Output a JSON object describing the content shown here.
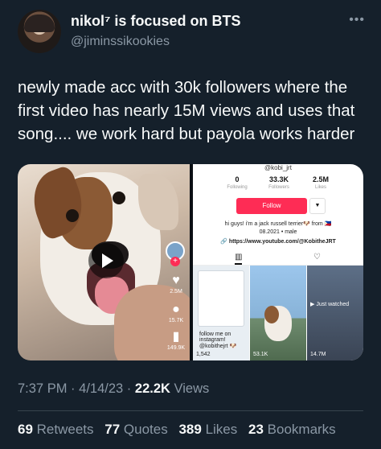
{
  "tweet": {
    "author": {
      "display_name": "nikol⁷ is focused on BTS",
      "handle": "@jiminssikookies"
    },
    "more_icon": "more-horizontal-icon",
    "text": "newly made acc with 30k followers where the first video has nearly 15M views and uses that song.... we work hard but payola works harder",
    "meta": {
      "time": "7:37 PM",
      "date": "4/14/23",
      "views_count": "22.2K",
      "views_label": "Views",
      "separator": "·"
    },
    "engagement": {
      "retweets_count": "69",
      "retweets_label": "Retweets",
      "quotes_count": "77",
      "quotes_label": "Quotes",
      "likes_count": "389",
      "likes_label": "Likes",
      "bookmarks_count": "23",
      "bookmarks_label": "Bookmarks"
    }
  },
  "media": {
    "left": {
      "likes": "2.5M",
      "comments": "15.7K",
      "shares": "149.9K",
      "plus": "+"
    },
    "right": {
      "username": "@kobi_jrt",
      "stats": [
        {
          "num": "0",
          "label": "Following"
        },
        {
          "num": "33.3K",
          "label": "Followers"
        },
        {
          "num": "2.5M",
          "label": "Likes"
        }
      ],
      "follow_label": "Follow",
      "dropdown_label": "▼",
      "bio_line1": "hi guys! i'm a jack russell terrier🐶 from 🇵🇭",
      "bio_line2": "08.2021 • male",
      "link": "🔗 https://www.youtube.com/@KobitheJRT",
      "grid": [
        {
          "views": "1,542",
          "tag": "follow me on instagram! @kobithejrt 🐶"
        },
        {
          "views": "53.1K",
          "tag": ""
        },
        {
          "views": "14.7M",
          "tag": "▶ Just watched"
        }
      ]
    }
  },
  "colors": {
    "background": "#15202b",
    "primary_text": "#f7f9f9",
    "secondary_text": "#8b98a5",
    "tiktok_red": "#fe2c55"
  }
}
